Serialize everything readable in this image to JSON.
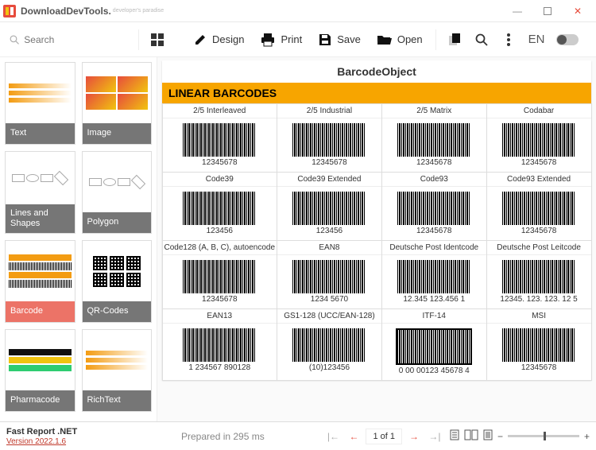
{
  "window": {
    "title_main": "DownloadDevTools",
    "title_suffix": ".",
    "subtitle": "developer's paradise"
  },
  "toolbar": {
    "search_placeholder": "Search",
    "design_label": "Design",
    "print_label": "Print",
    "save_label": "Save",
    "open_label": "Open",
    "language": "EN"
  },
  "sidebar": {
    "items": [
      {
        "label": "Text",
        "kind": "text"
      },
      {
        "label": "Image",
        "kind": "image"
      },
      {
        "label": "Lines and Shapes",
        "kind": "shapes"
      },
      {
        "label": "Polygon",
        "kind": "shapes"
      },
      {
        "label": "Barcode",
        "kind": "barcode",
        "selected": true
      },
      {
        "label": "QR-Codes",
        "kind": "qr"
      },
      {
        "label": "Pharmacode",
        "kind": "pharma"
      },
      {
        "label": "RichText",
        "kind": "text"
      }
    ]
  },
  "page": {
    "title": "BarcodeObject",
    "section": "LINEAR BARCODES",
    "cells": [
      {
        "t": "2/5 Interleaved",
        "v": "12345678"
      },
      {
        "t": "2/5 Industrial",
        "v": "12345678"
      },
      {
        "t": "2/5 Matrix",
        "v": "12345678"
      },
      {
        "t": "Codabar",
        "v": "12345678"
      },
      {
        "t": "Code39",
        "v": "123456"
      },
      {
        "t": "Code39 Extended",
        "v": "123456"
      },
      {
        "t": "Code93",
        "v": "12345678"
      },
      {
        "t": "Code93 Extended",
        "v": "12345678"
      },
      {
        "t": "Code128 (A, B, C), autoencode",
        "v": "12345678"
      },
      {
        "t": "EAN8",
        "v": "1234 5670"
      },
      {
        "t": "Deutsche Post Identcode",
        "v": "12.345 123.456 1"
      },
      {
        "t": "Deutsche Post Leitcode",
        "v": "12345. 123. 123. 12 5"
      },
      {
        "t": "EAN13",
        "v": "1 234567 890128"
      },
      {
        "t": "GS1-128 (UCC/EAN-128)",
        "v": "(10)123456"
      },
      {
        "t": "ITF-14",
        "v": "0 00 00123 45678 4",
        "box": true
      },
      {
        "t": "MSI",
        "v": "12345678"
      }
    ]
  },
  "status": {
    "product": "Fast Report .NET",
    "version": "Version 2022.1.6",
    "prepared": "Prepared in 295 ms",
    "pager": "1  of  1"
  }
}
